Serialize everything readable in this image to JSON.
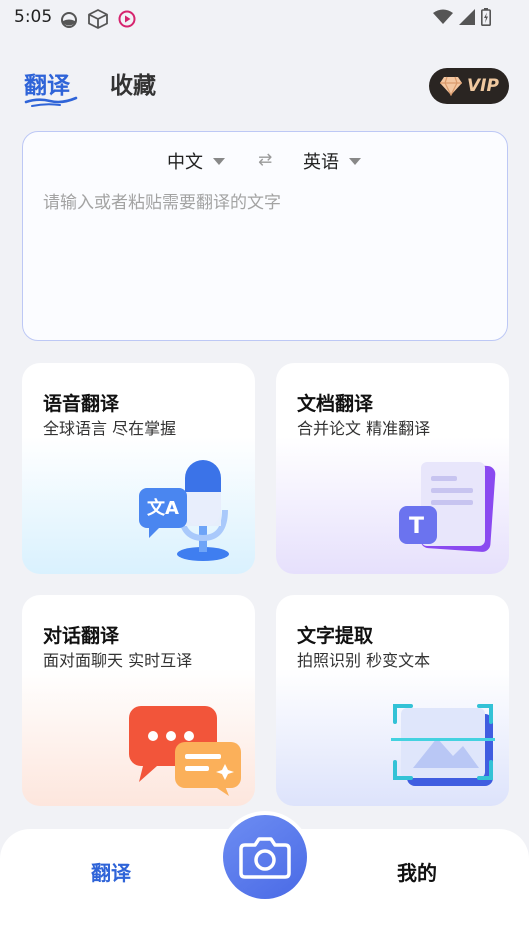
{
  "status_bar": {
    "time": "5:05",
    "left_icons": [
      "drop-icon",
      "cube-icon",
      "media-icon"
    ],
    "right_icons": [
      "wifi-icon",
      "signal-icon",
      "battery-icon"
    ]
  },
  "top_tabs": {
    "translate": "翻译",
    "favorites": "收藏"
  },
  "vip": {
    "label": "VIP",
    "accent": "#f0c9a0"
  },
  "translator": {
    "source_lang": "中文",
    "target_lang": "英语",
    "swap_icon": "⇄",
    "placeholder": "请输入或者粘贴需要翻译的文字"
  },
  "cards": {
    "voice": {
      "title": "语音翻译",
      "subtitle": "全球语言 尽在掌握"
    },
    "document": {
      "title": "文档翻译",
      "subtitle": "合并论文 精准翻译"
    },
    "dialog": {
      "title": "对话翻译",
      "subtitle": "面对面聊天 实时互译"
    },
    "ocr": {
      "title": "文字提取",
      "subtitle": "拍照识别 秒变文本"
    }
  },
  "bottom_nav": {
    "translate": "翻译",
    "mine": "我的"
  },
  "colors": {
    "accent": "#2f64d8",
    "background": "#f1f2f6"
  }
}
